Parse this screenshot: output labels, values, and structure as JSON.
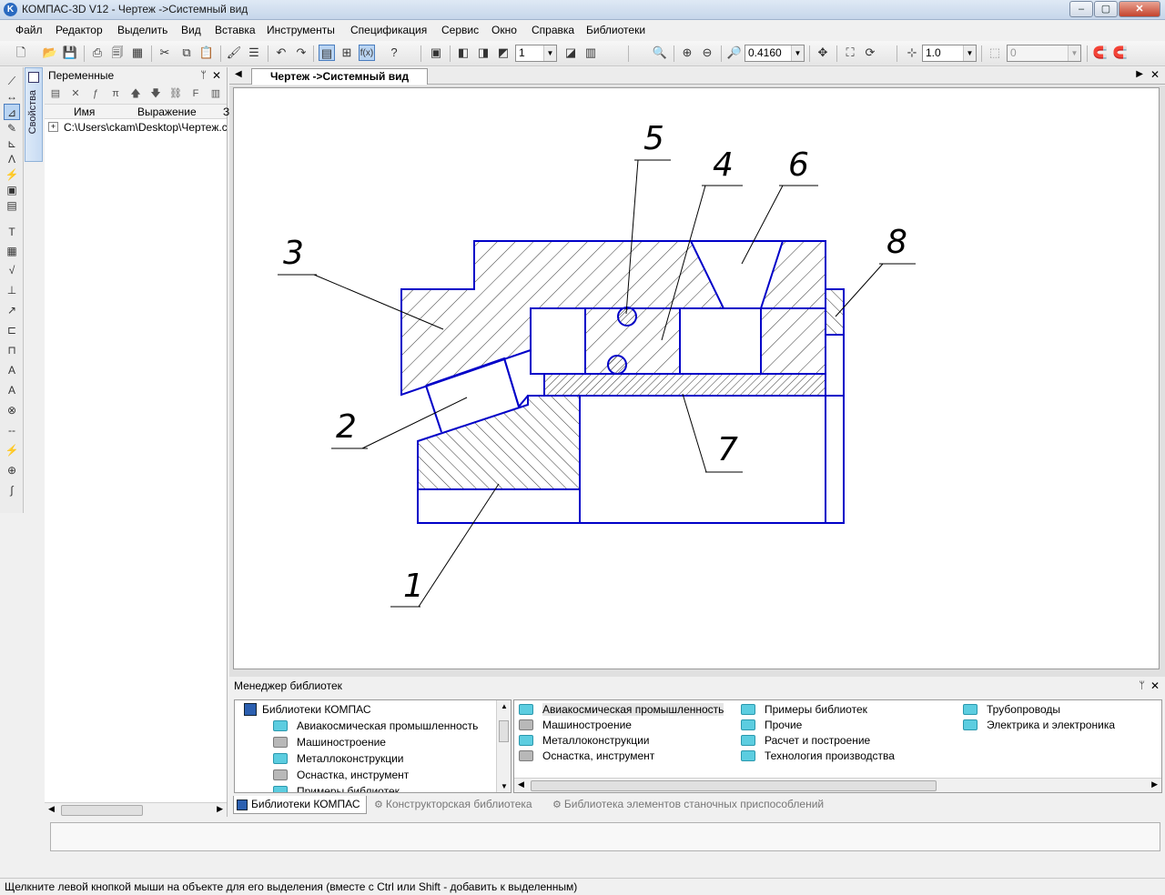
{
  "window": {
    "title": "КОМПАС-3D V12 - Чертеж ->Системный вид",
    "app_icon": "K",
    "min_glyph": "–",
    "max_glyph": "▢",
    "close_glyph": "✕"
  },
  "menu": [
    "Файл",
    "Редактор",
    "Выделить",
    "Вид",
    "Вставка",
    "Инструменты",
    "Спецификация",
    "Сервис",
    "Окно",
    "Справка",
    "Библиотеки"
  ],
  "toolbar": {
    "layer_value": "1",
    "zoom_value": "0.4160",
    "step_value": "1.0",
    "angle_value": "0",
    "fx_label": "f(x)"
  },
  "properties_tab": {
    "label": "Свойства"
  },
  "variables_panel": {
    "title": "Переменные",
    "pin": "ᛘ",
    "close": "✕",
    "columns": [
      "Имя",
      "Выражение",
      "З"
    ],
    "rows": [
      {
        "expander": "+",
        "path": "C:\\Users\\ckam\\Desktop\\Чертеж.c"
      }
    ]
  },
  "document_tab": {
    "label": "Чертеж ->Системный вид"
  },
  "drawing": {
    "callouts": [
      "1",
      "2",
      "3",
      "4",
      "5",
      "6",
      "7",
      "8"
    ],
    "line_color": "#0000c8",
    "hatch_color": "#000000"
  },
  "library_manager": {
    "title": "Менеджер библиотек",
    "tree_root": "Библиотеки КОМПАС",
    "tree_items": [
      "Авиакосмическая промышленность",
      "Машиностроение",
      "Металлоконструкции",
      "Оснастка, инструмент",
      "Примеры библиотек"
    ],
    "categories": [
      {
        "label": "Авиакосмическая промышленность",
        "color": "cyan",
        "selected": true
      },
      {
        "label": "Машиностроение",
        "color": "gray"
      },
      {
        "label": "Металлоконструкции",
        "color": "cyan"
      },
      {
        "label": "Оснастка, инструмент",
        "color": "gray"
      },
      {
        "label": "Примеры библиотек",
        "color": "cyan"
      },
      {
        "label": "Прочие",
        "color": "cyan"
      },
      {
        "label": "Расчет и построение",
        "color": "cyan"
      },
      {
        "label": "Технология производства",
        "color": "cyan"
      },
      {
        "label": "Трубопроводы",
        "color": "cyan"
      },
      {
        "label": "Электрика и электроника",
        "color": "cyan"
      }
    ],
    "tabs": [
      "Библиотеки КОМПАС",
      "Конструкторская библиотека",
      "Библиотека элементов станочных приспособлений"
    ]
  },
  "status_bar": {
    "hint": "Щелкните левой кнопкой мыши на объекте для его выделения (вместе с Ctrl или Shift - добавить к выделенным)"
  }
}
